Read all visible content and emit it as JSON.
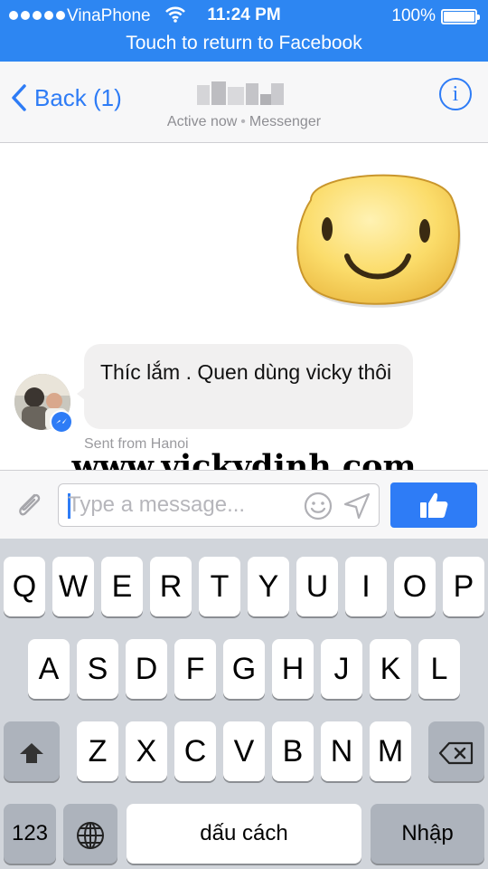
{
  "status_bar": {
    "carrier": "VinaPhone",
    "time": "11:24 PM",
    "battery": "100%",
    "battery_level": 1.0,
    "signal_dots": 5,
    "wifi_icon": "wifi-icon"
  },
  "banner": {
    "text": "Touch to return to Facebook"
  },
  "nav": {
    "back_label": "Back (1)",
    "active_status": "Active now",
    "separator": "•",
    "app_name": "Messenger",
    "info_icon": "info-icon"
  },
  "messages": {
    "incoming_text": "Thíc lắm . Quen dùng vicky thôi",
    "sent_from": "Sent from Hanoi",
    "sticker": "smiley-sticker"
  },
  "watermark": "www.vickydinh.com",
  "composer": {
    "placeholder": "Type a message...",
    "value": "",
    "attach_icon": "paperclip-icon",
    "emoji_icon": "smiley-icon",
    "send_icon": "send-arrow-icon",
    "like_icon": "thumbs-up-icon"
  },
  "keyboard": {
    "row1": [
      "Q",
      "W",
      "E",
      "R",
      "T",
      "Y",
      "U",
      "I",
      "O",
      "P"
    ],
    "row2": [
      "A",
      "S",
      "D",
      "F",
      "G",
      "H",
      "J",
      "K",
      "L"
    ],
    "row3": [
      "Z",
      "X",
      "C",
      "V",
      "B",
      "N",
      "M"
    ],
    "numbers_label": "123",
    "space_label": "dấu cách",
    "return_label": "Nhập",
    "shift_icon": "shift-arrow-icon",
    "delete_icon": "backspace-icon",
    "globe_icon": "globe-icon"
  },
  "colors": {
    "accent": "#2e7cf6",
    "banner": "#2d86f2",
    "keyboard_bg": "#d1d5db"
  }
}
